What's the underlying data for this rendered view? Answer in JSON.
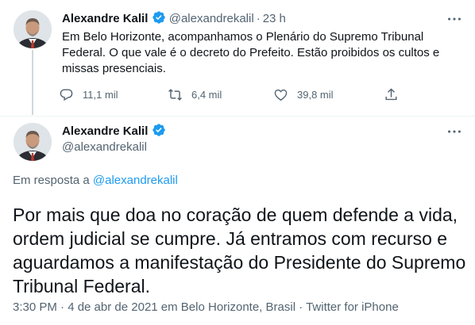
{
  "thread_tweet": {
    "author_name": "Alexandre Kalil",
    "handle": "@alexandrekalil",
    "time_ago": "23 h",
    "text": "Em Belo Horizonte, acompanhamos o Plenário do Supremo Tribunal Federal. O que vale é o decreto do Prefeito. Estão proibidos os cultos e missas presenciais.",
    "replies": "11,1 mil",
    "retweets": "6,4 mil",
    "likes": "39,8 mil"
  },
  "main_tweet": {
    "author_name": "Alexandre Kalil",
    "handle": "@alexandrekalil",
    "reply_prefix": "Em resposta a",
    "reply_to": "@alexandrekalil",
    "text": "Por mais que doa no coração de quem defende a vida, ordem judicial se cumpre. Já entramos com recurso e aguardamos a manifestação do Presidente do Supremo Tribunal Federal.",
    "meta": "3:30 PM · 4 de abr de 2021 em Belo Horizonte, Brasil · Twitter for iPhone"
  },
  "colors": {
    "accent": "#1d9bf0",
    "secondary_text": "#536471",
    "text": "#0f1419"
  },
  "icons": [
    "verified-badge-icon",
    "more-options-icon",
    "reply-icon",
    "retweet-icon",
    "like-icon",
    "share-icon"
  ]
}
